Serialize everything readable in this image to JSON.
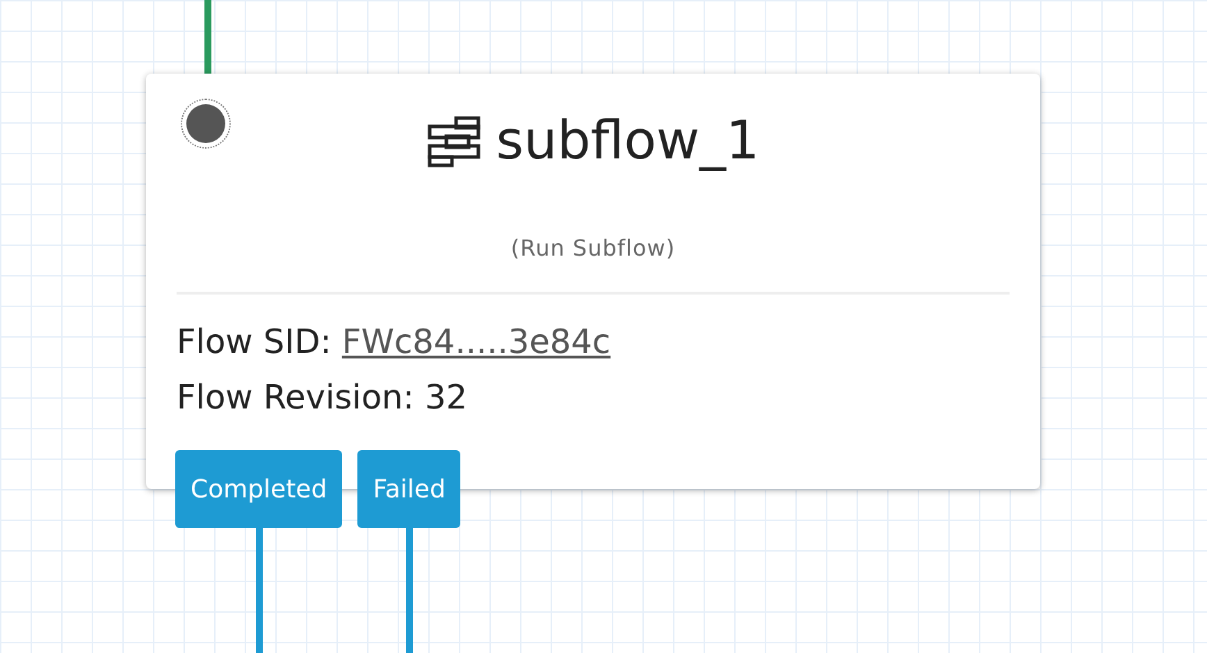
{
  "node": {
    "title": "subflow_1",
    "subtitle": "(Run Subflow)",
    "fields": [
      {
        "label": "Flow SID: ",
        "value": "FWc84.....3e84c",
        "kind": "link"
      },
      {
        "label": "Flow Revision: ",
        "value": "32",
        "kind": "text"
      }
    ]
  },
  "transitions": [
    {
      "label": "Completed"
    },
    {
      "label": "Failed"
    }
  ]
}
